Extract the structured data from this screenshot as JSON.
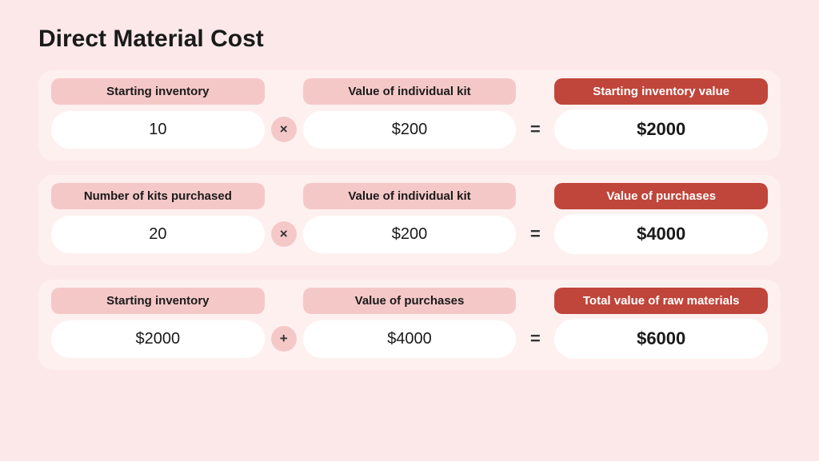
{
  "title": "Direct Material Cost",
  "groups": [
    {
      "id": "group1",
      "labels": [
        {
          "text": "Starting inventory",
          "highlight": false
        },
        {
          "text": "Value of individual kit",
          "highlight": false
        },
        {
          "text": "Starting inventory value",
          "highlight": true
        }
      ],
      "operator1": "×",
      "operator2": "=",
      "values": [
        "10",
        "$200",
        "$2000"
      ],
      "result_bold": true
    },
    {
      "id": "group2",
      "labels": [
        {
          "text": "Number of kits purchased",
          "highlight": false
        },
        {
          "text": "Value of individual kit",
          "highlight": false
        },
        {
          "text": "Value of purchases",
          "highlight": true
        }
      ],
      "operator1": "×",
      "operator2": "=",
      "values": [
        "20",
        "$200",
        "$4000"
      ],
      "result_bold": true
    },
    {
      "id": "group3",
      "labels": [
        {
          "text": "Starting inventory",
          "highlight": false
        },
        {
          "text": "Value of purchases",
          "highlight": false
        },
        {
          "text": "Total value of raw materials",
          "highlight": true
        }
      ],
      "operator1": "+",
      "operator2": "=",
      "values": [
        "$2000",
        "$4000",
        "$6000"
      ],
      "result_bold": true
    }
  ]
}
